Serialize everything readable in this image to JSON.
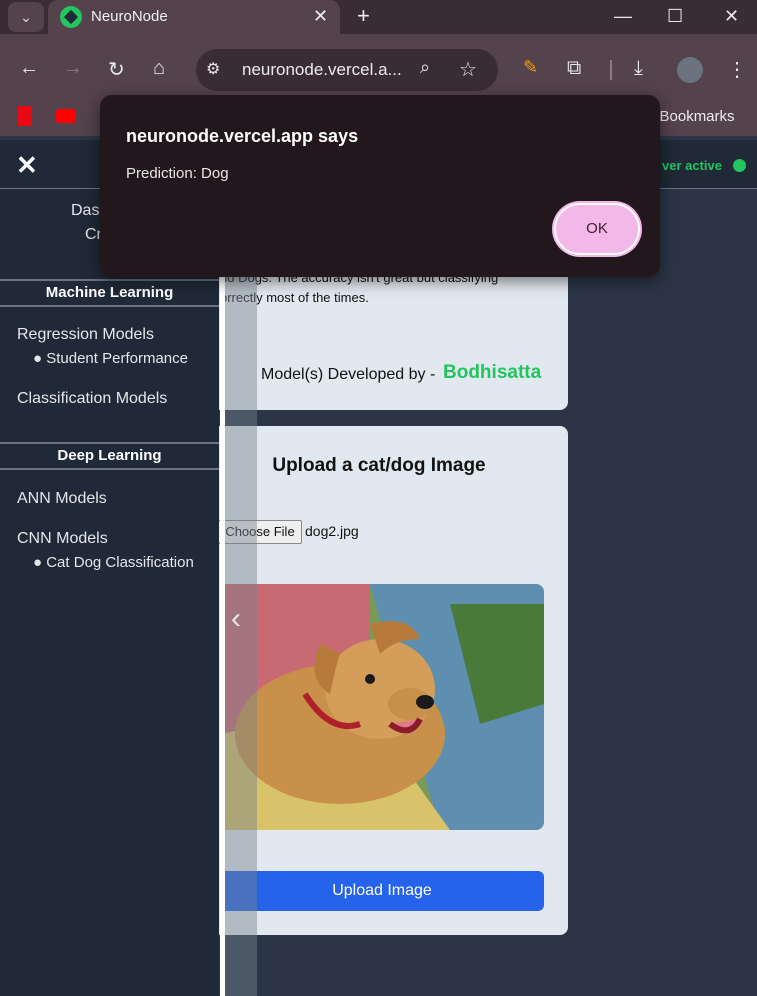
{
  "browser": {
    "tab_title": "NeuroNode",
    "url": "neuronode.vercel.a...",
    "bookmarks_label": "l Bookmarks",
    "new_tab": "+",
    "tab_close": "✕",
    "window_min": "—",
    "window_max": "☐",
    "window_close": "✕"
  },
  "app": {
    "server_status": "ver active",
    "close_menu": "✕"
  },
  "sidebar": {
    "top_items": [
      "Dasl",
      "Cr"
    ],
    "sections": [
      {
        "heading": "Machine Learning",
        "items": [
          {
            "label": "Regression Models"
          },
          {
            "label": "● Student Performance"
          },
          {
            "label": "Classification Models"
          }
        ]
      },
      {
        "heading": "Deep Learning",
        "items": [
          {
            "label": "ANN Models"
          },
          {
            "label": "CNN Models"
          },
          {
            "label": "● Cat Dog Classification"
          }
        ]
      }
    ]
  },
  "main": {
    "description_line1": "nd Dogs. The accuracy isn't great but classifying",
    "description_line2": "orrectly most of the times.",
    "developed_by_label": "Model(s) Developed by -",
    "developer_name": "Bodhisatta",
    "upload_heading": "Upload a cat/dog Image",
    "choose_file_label": "Choose File",
    "file_name": "dog2.jpg",
    "upload_button": "Upload Image",
    "image_subject": "dog-photo"
  },
  "dialog": {
    "title": "neuronode.vercel.app says",
    "message": "Prediction: Dog",
    "ok_label": "OK"
  },
  "colors": {
    "accent_green": "#22c55e",
    "upload_blue": "#2563eb",
    "ok_pink": "#f4b8e8"
  }
}
